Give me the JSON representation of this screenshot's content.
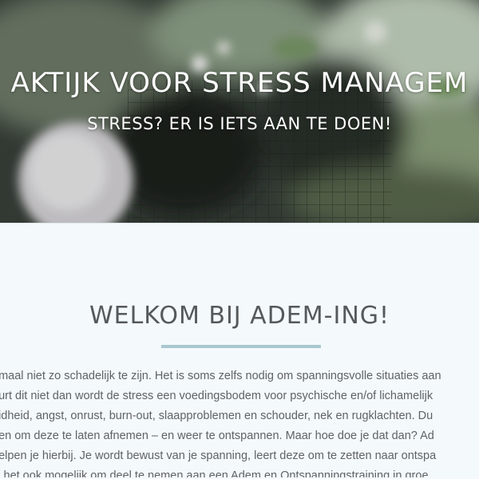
{
  "hero": {
    "title": "AKTIJK VOOR STRESS MANAGEM",
    "subtitle": "STRESS? ER IS IETS AAN TE DOEN!"
  },
  "main": {
    "heading": "WELKOM BIJ ADEM-ING!",
    "accent_color": "#a9c8d0",
    "paragraph_lines": [
      "emaal niet zo schadelijk te zijn. Het is soms zelfs nodig om spanningsvolle situaties aan",
      "eurt dit niet dan wordt de stress een voedingsbodem voor psychische en/of lichamelijk",
      "eidheid, angst, onrust, burn-out, slaapproblemen en schouder, nek en rugklachten. Du",
      "oen om deze te laten afnemen – en weer te ontspannen. Maar hoe doe je dat dan? Ad",
      "helpen je hierbij. Je wordt bewust van je spanning, leert deze om te zetten naar ontspa",
      "is het ook mogelijk om deel te nemen aan een Adem en Ontspanningstraining in groe"
    ]
  }
}
